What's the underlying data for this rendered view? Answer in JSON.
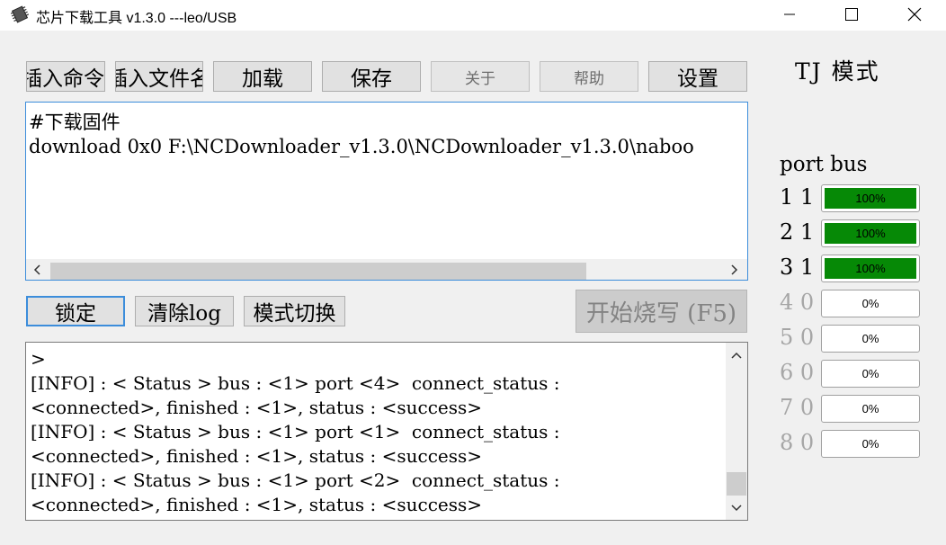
{
  "window": {
    "title": "芯片下载工具 v1.3.0 ---leo/USB",
    "icon": "chip-icon",
    "controls": [
      "minimize-icon",
      "maximize-icon",
      "close-icon"
    ]
  },
  "toolbar": {
    "insert_command": "插入命令",
    "insert_file": "插入文件名",
    "load": "加载",
    "save": "保存",
    "about": "关于",
    "help": "帮助",
    "settings": "设置"
  },
  "editor": {
    "lines": [
      "#下载固件",
      "download 0x0 F:\\NCDownloader_v1.3.0\\NCDownloader_v1.3.0\\naboo"
    ]
  },
  "actions": {
    "lock": "锁定",
    "clear_log": "清除log",
    "mode_switch": "模式切换",
    "start_burn": "开始烧写 (F5)"
  },
  "log": {
    "lines": [
      ">",
      "[INFO] : < Status > bus : <1> port <4>  connect_status :",
      "<connected>, finished : <1>, status : <success>",
      "[INFO] : < Status > bus : <1> port <1>  connect_status :",
      "<connected>, finished : <1>, status : <success>",
      "[INFO] : < Status > bus : <1> port <2>  connect_status :",
      "<connected>, finished : <1>, status : <success>"
    ]
  },
  "mode": {
    "title": "TJ 模式"
  },
  "ports": {
    "header": "port bus",
    "items": [
      {
        "port": "1",
        "bus": "1",
        "progress": 100,
        "text": "100%",
        "active": true
      },
      {
        "port": "2",
        "bus": "1",
        "progress": 100,
        "text": "100%",
        "active": true
      },
      {
        "port": "3",
        "bus": "1",
        "progress": 100,
        "text": "100%",
        "active": true
      },
      {
        "port": "4",
        "bus": "0",
        "progress": 0,
        "text": "0%",
        "active": false
      },
      {
        "port": "5",
        "bus": "0",
        "progress": 0,
        "text": "0%",
        "active": false
      },
      {
        "port": "6",
        "bus": "0",
        "progress": 0,
        "text": "0%",
        "active": false
      },
      {
        "port": "7",
        "bus": "0",
        "progress": 0,
        "text": "0%",
        "active": false
      },
      {
        "port": "8",
        "bus": "0",
        "progress": 0,
        "text": "0%",
        "active": false
      }
    ]
  },
  "colors": {
    "progress_fill": "#068906",
    "editor_border": "#3c8ddb",
    "lock_border": "#3c8ddb"
  }
}
